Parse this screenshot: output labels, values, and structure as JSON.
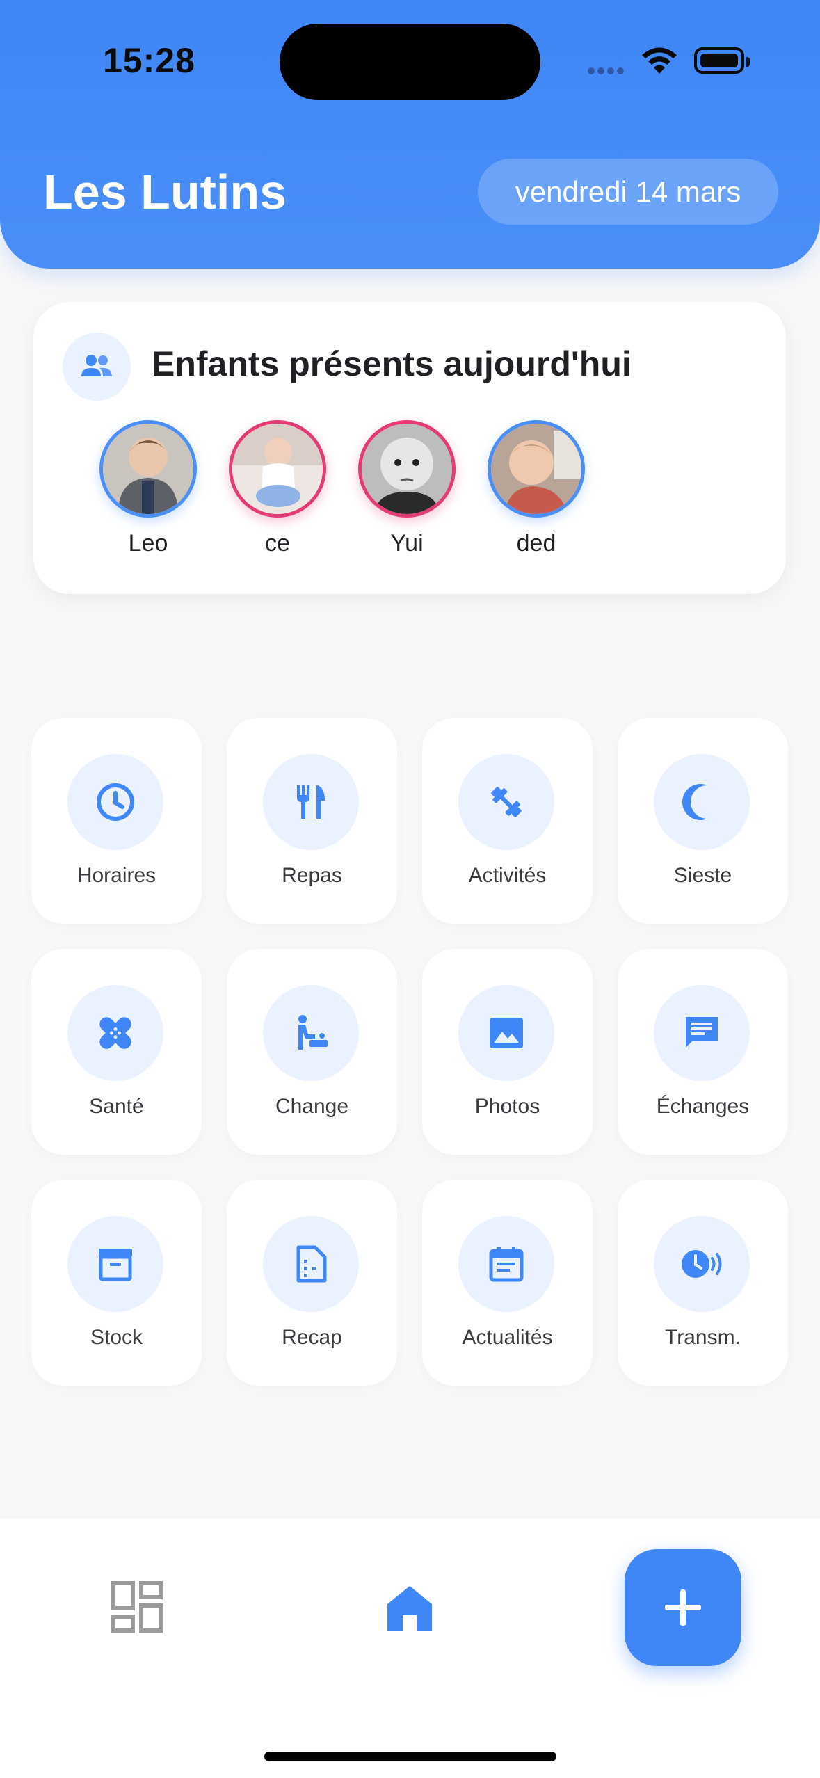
{
  "status": {
    "time": "15:28"
  },
  "header": {
    "title": "Les Lutins",
    "date": "vendredi 14 mars"
  },
  "children_card": {
    "title": "Enfants présents aujourd'hui",
    "children": [
      {
        "name": "Leo",
        "ring": "blue"
      },
      {
        "name": "ce",
        "ring": "pink"
      },
      {
        "name": "Yui",
        "ring": "pink"
      },
      {
        "name": "ded",
        "ring": "blue"
      }
    ]
  },
  "tiles": [
    {
      "label": "Horaires",
      "icon": "clock-icon"
    },
    {
      "label": "Repas",
      "icon": "utensils-icon"
    },
    {
      "label": "Activités",
      "icon": "dumbbell-icon"
    },
    {
      "label": "Sieste",
      "icon": "moon-icon"
    },
    {
      "label": "Santé",
      "icon": "bandage-icon"
    },
    {
      "label": "Change",
      "icon": "baby-changing-icon"
    },
    {
      "label": "Photos",
      "icon": "image-icon"
    },
    {
      "label": "Échanges",
      "icon": "chat-icon"
    },
    {
      "label": "Stock",
      "icon": "archive-box-icon"
    },
    {
      "label": "Recap",
      "icon": "document-icon"
    },
    {
      "label": "Actualités",
      "icon": "calendar-icon"
    },
    {
      "label": "Transm.",
      "icon": "time-audio-icon"
    }
  ],
  "bottom_nav": {
    "items": [
      {
        "icon": "dashboard-icon",
        "active": false
      },
      {
        "icon": "home-icon",
        "active": true
      }
    ],
    "fab_icon": "plus-icon"
  },
  "colors": {
    "primary": "#3F86F7",
    "accent_pink": "#E43B74",
    "icon_bg": "#EAF1FF",
    "background": "#F8F8F8"
  }
}
